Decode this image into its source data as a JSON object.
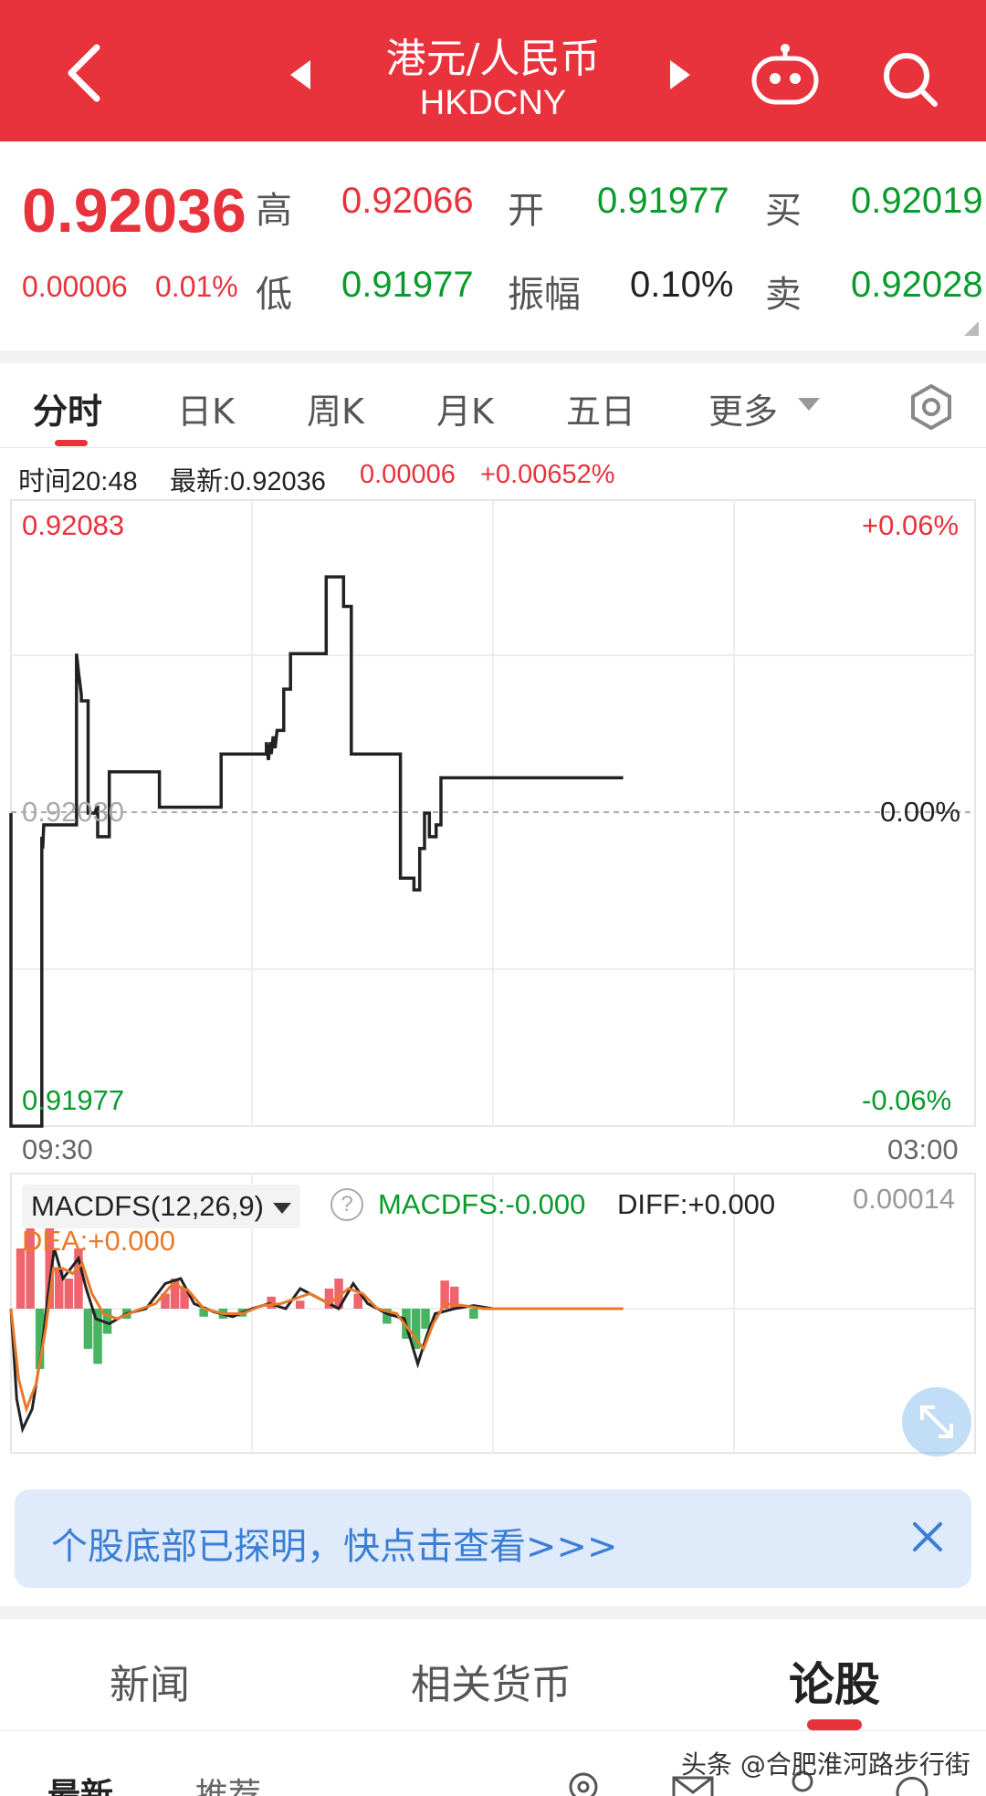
{
  "header": {
    "title": "港元/人民币",
    "subtitle": "HKDCNY",
    "bg_color": "#e8323c"
  },
  "quote": {
    "price": "0.92036",
    "change": "0.00006",
    "change_pct": "0.01%",
    "high_label": "高",
    "high": "0.92066",
    "open_label": "开",
    "open": "0.91977",
    "buy_label": "买",
    "buy": "0.92019",
    "low_label": "低",
    "low": "0.91977",
    "amp_label": "振幅",
    "amp": "0.10%",
    "sell_label": "卖",
    "sell": "0.92028"
  },
  "tabs": [
    "分时",
    "日K",
    "周K",
    "月K",
    "五日",
    "更多"
  ],
  "info": {
    "time": "时间20:48",
    "latest": "最新:0.92036",
    "chg": "0.00006",
    "chg_pct": "+0.00652%"
  },
  "chart_axis": {
    "y_max": "0.92083",
    "y_mid": "0.92030",
    "y_min": "0.91977",
    "pct_max": "+0.06%",
    "pct_mid": "0.00%",
    "pct_min": "-0.06%",
    "x_start": "09:30",
    "x_end": "03:00"
  },
  "macd": {
    "name": "MACDFS(12,26,9)",
    "value": "MACDFS:-0.000",
    "diff": "DIFF:+0.000",
    "dea": "DEA:+0.000",
    "scale_max": "0.00014"
  },
  "chart_data": {
    "type": "line",
    "x_range": [
      0,
      100
    ],
    "ylim": [
      0.91977,
      0.92083
    ],
    "series": [
      {
        "x": [
          0,
          0,
          3.2,
          3.2,
          3.3,
          3.4,
          3.6,
          3.6,
          6.8,
          6.8,
          7.0,
          7.3,
          7.3,
          8.0,
          8.0,
          8.7,
          8.9,
          9.0,
          9.0,
          10.2,
          10.2,
          15.4,
          15.4,
          21.8,
          21.8,
          26.5,
          26.5,
          26.7,
          26.9,
          27.0,
          27.2,
          27.4,
          27.6,
          27.8,
          28.3,
          28.3,
          29.0,
          29.0,
          29.4,
          29.4,
          32.7,
          32.7,
          34.5,
          34.5,
          35.3,
          35.3,
          40.4,
          40.4,
          41.8,
          41.8,
          42.4,
          42.4,
          42.9,
          42.9,
          43.4,
          43.4,
          44.1,
          44.1,
          44.6,
          44.6,
          63.5
        ],
        "values": [
          0.9203,
          0.91977,
          0.91977,
          0.92026,
          0.92024,
          0.92028,
          0.92028,
          0.92028,
          0.92028,
          0.92057,
          0.92054,
          0.9205,
          0.92049,
          0.92049,
          0.9203,
          0.9203,
          0.92031,
          0.92031,
          0.92026,
          0.92026,
          0.92037,
          0.92037,
          0.92031,
          0.92031,
          0.9204,
          0.9204,
          0.92042,
          0.92039,
          0.92042,
          0.9204,
          0.92043,
          0.92041,
          0.92044,
          0.92044,
          0.92044,
          0.92051,
          0.92051,
          0.92057,
          0.92057,
          0.92057,
          0.92057,
          0.9207,
          0.9207,
          0.92065,
          0.92065,
          0.9204,
          0.9204,
          0.92019,
          0.92019,
          0.92017,
          0.92017,
          0.92024,
          0.92024,
          0.9203,
          0.9203,
          0.92026,
          0.92026,
          0.92028,
          0.92028,
          0.92036,
          0.92036
        ]
      }
    ],
    "histogram": [
      {
        "x": 1,
        "v": 60
      },
      {
        "x": 2,
        "v": 80
      },
      {
        "x": 3,
        "v": -60
      },
      {
        "x": 4,
        "v": 110
      },
      {
        "x": 5,
        "v": 40
      },
      {
        "x": 6,
        "v": 30
      },
      {
        "x": 7,
        "v": 60
      },
      {
        "x": 8,
        "v": -40
      },
      {
        "x": 9,
        "v": -55
      },
      {
        "x": 10,
        "v": -25
      },
      {
        "x": 12,
        "v": -10
      },
      {
        "x": 16,
        "v": 15
      },
      {
        "x": 17,
        "v": 30
      },
      {
        "x": 18,
        "v": 20
      },
      {
        "x": 20,
        "v": -8
      },
      {
        "x": 22,
        "v": -10
      },
      {
        "x": 24,
        "v": -8
      },
      {
        "x": 27,
        "v": 12
      },
      {
        "x": 30,
        "v": 8
      },
      {
        "x": 33,
        "v": 20
      },
      {
        "x": 34,
        "v": 30
      },
      {
        "x": 36,
        "v": 15
      },
      {
        "x": 39,
        "v": -15
      },
      {
        "x": 41,
        "v": -30
      },
      {
        "x": 42,
        "v": -40
      },
      {
        "x": 43,
        "v": -20
      },
      {
        "x": 45,
        "v": 28
      },
      {
        "x": 46,
        "v": 22
      },
      {
        "x": 48,
        "v": -10
      }
    ],
    "diff": [
      [
        0,
        0
      ],
      [
        0.6,
        -90
      ],
      [
        1.2,
        -120
      ],
      [
        2.2,
        -100
      ],
      [
        3.2,
        -40
      ],
      [
        3.8,
        10
      ],
      [
        4.5,
        60
      ],
      [
        5.4,
        30
      ],
      [
        6.2,
        40
      ],
      [
        7.0,
        50
      ],
      [
        7.8,
        20
      ],
      [
        8.8,
        -10
      ],
      [
        10.2,
        -15
      ],
      [
        12,
        -5
      ],
      [
        14,
        0
      ],
      [
        16,
        25
      ],
      [
        17.6,
        30
      ],
      [
        19,
        5
      ],
      [
        21,
        -3
      ],
      [
        23,
        -8
      ],
      [
        25,
        0
      ],
      [
        26.8,
        5
      ],
      [
        28.5,
        0
      ],
      [
        30,
        20
      ],
      [
        32,
        10
      ],
      [
        34,
        0
      ],
      [
        35.5,
        25
      ],
      [
        37,
        5
      ],
      [
        39,
        -5
      ],
      [
        40.8,
        -10
      ],
      [
        42.2,
        -55
      ],
      [
        43.2,
        -25
      ],
      [
        44,
        -5
      ],
      [
        46,
        0
      ],
      [
        48,
        3
      ],
      [
        50,
        0
      ],
      [
        63.5,
        0
      ]
    ],
    "dea": [
      [
        0,
        0
      ],
      [
        0.8,
        -70
      ],
      [
        1.6,
        -100
      ],
      [
        2.6,
        -75
      ],
      [
        3.6,
        -20
      ],
      [
        4.4,
        40
      ],
      [
        5.4,
        40
      ],
      [
        6.4,
        35
      ],
      [
        7.4,
        45
      ],
      [
        8.4,
        15
      ],
      [
        9.6,
        -5
      ],
      [
        11,
        -10
      ],
      [
        13,
        -2
      ],
      [
        15,
        5
      ],
      [
        16.8,
        25
      ],
      [
        18.4,
        18
      ],
      [
        20,
        0
      ],
      [
        22,
        -5
      ],
      [
        24,
        -5
      ],
      [
        26,
        3
      ],
      [
        28,
        5
      ],
      [
        29.5,
        10
      ],
      [
        31,
        15
      ],
      [
        33,
        5
      ],
      [
        35,
        20
      ],
      [
        36.5,
        15
      ],
      [
        38,
        0
      ],
      [
        40,
        -5
      ],
      [
        41.6,
        -25
      ],
      [
        42.8,
        -40
      ],
      [
        43.8,
        -15
      ],
      [
        45,
        5
      ],
      [
        47,
        3
      ],
      [
        49,
        0
      ],
      [
        63.5,
        0
      ]
    ],
    "colors": {
      "price": "#222222",
      "diff": "#222222",
      "dea": "#e8792a",
      "hist_pos": "#e8323c",
      "hist_neg": "#0a9b2c"
    }
  },
  "banner": {
    "text": "个股底部已探明，快点击查看>>>"
  },
  "bottom_tabs": [
    "新闻",
    "相关货币",
    "论股"
  ],
  "sub_tabs": [
    "最新",
    "推荐"
  ],
  "watermark": "头条 @合肥淮河路步行街"
}
